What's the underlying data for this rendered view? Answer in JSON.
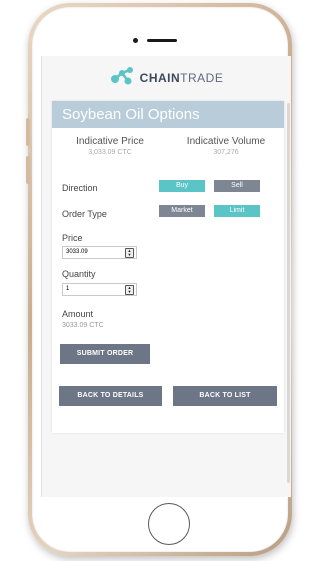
{
  "app": {
    "logo_bold": "CHAIN",
    "logo_light": "TRADE",
    "brand_color": "#5bc4c7"
  },
  "card": {
    "title": "Soybean Oil Options",
    "indicative_price_label": "Indicative Price",
    "indicative_price_value": "3,033.09 CTC",
    "indicative_volume_label": "Indicative Volume",
    "indicative_volume_value": "307,276"
  },
  "form": {
    "direction_label": "Direction",
    "buy_label": "Buy",
    "sell_label": "Sell",
    "order_type_label": "Order Type",
    "market_label": "Market",
    "limit_label": "Limit",
    "price_label": "Price",
    "price_value": "3033.09",
    "quantity_label": "Quantity",
    "quantity_value": "1",
    "amount_label": "Amount",
    "amount_value": "3033.09 CTC",
    "submit_label": "SUBMIT ORDER"
  },
  "nav": {
    "back_details_label": "BACK TO DETAILS",
    "back_list_label": "BACK TO LIST"
  },
  "icons": {
    "logo": "chain-nodes-icon",
    "stepper": "up-down-arrows-icon"
  }
}
